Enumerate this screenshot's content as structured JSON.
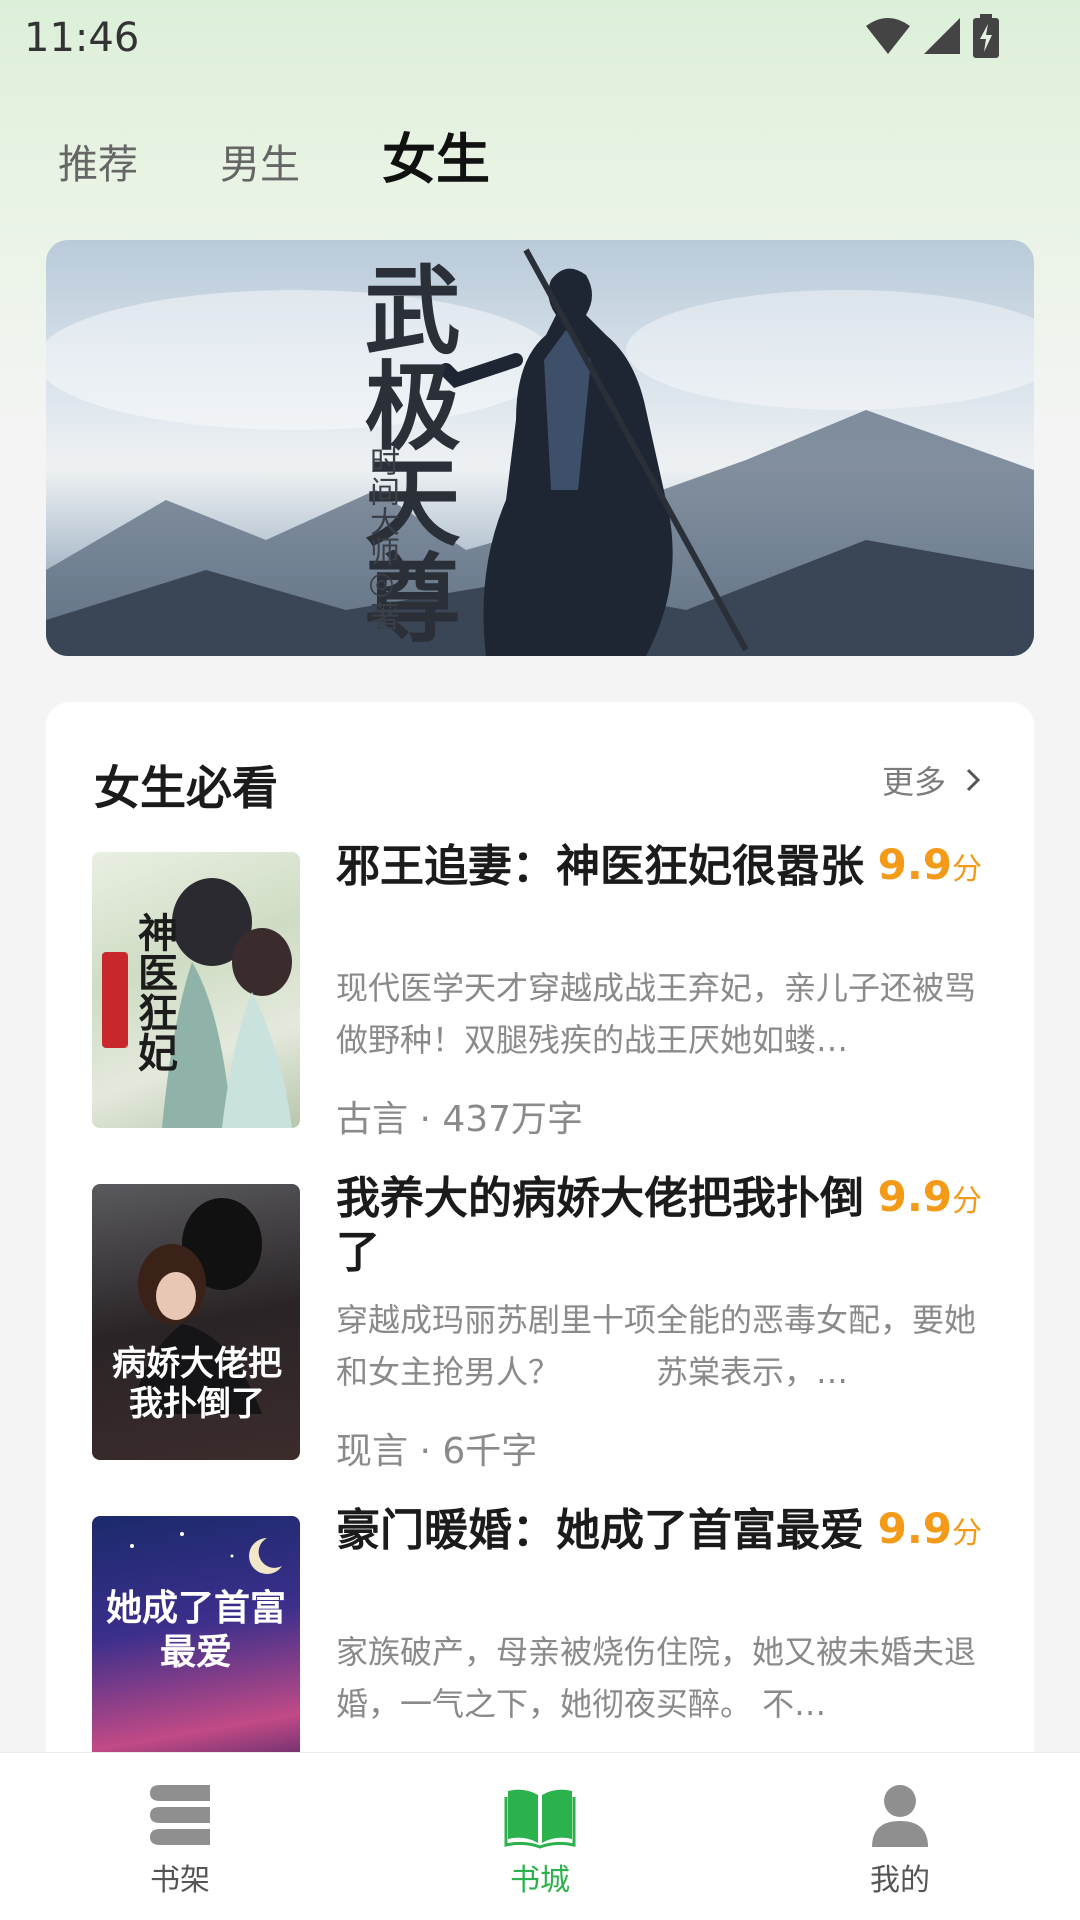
{
  "status_bar": {
    "time": "11:46"
  },
  "tabs": [
    {
      "label": "推荐",
      "active": false
    },
    {
      "label": "男生",
      "active": false
    },
    {
      "label": "女生",
      "active": true
    }
  ],
  "banner": {
    "title": "武极天尊",
    "author": "时间大师◎著"
  },
  "section": {
    "title": "女生必看",
    "more_label": "更多"
  },
  "books": [
    {
      "title": "邪王追妻：神医狂妃很嚣张",
      "rating": "9.9",
      "rating_unit": "分",
      "description": "现代医学天才穿越成战王弃妃，亲儿子还被骂做野种！双腿残疾的战王厌她如蝼…",
      "meta": "古言 · 437万字",
      "cover_text": "神医狂妃"
    },
    {
      "title": "我养大的病娇大佬把我扑倒了",
      "rating": "9.9",
      "rating_unit": "分",
      "description": "穿越成玛丽苏剧里十项全能的恶毒女配，要她和女主抢男人？　　　苏棠表示，…",
      "meta": "现言 · 6千字",
      "cover_text": "病娇大佬把我扑倒了"
    },
    {
      "title": "豪门暖婚：她成了首富最爱",
      "rating": "9.9",
      "rating_unit": "分",
      "description": "家族破产，母亲被烧伤住院，她又被未婚夫退婚，一气之下，她彻夜买醉。 不…",
      "meta": "",
      "cover_text": "她成了首富最爱"
    }
  ],
  "bottom_nav": [
    {
      "label": "书架",
      "icon": "bookshelf-icon",
      "active": false
    },
    {
      "label": "书城",
      "icon": "open-book-icon",
      "active": true
    },
    {
      "label": "我的",
      "icon": "user-icon",
      "active": false
    }
  ],
  "colors": {
    "accent": "#2bb24c",
    "rating": "#f39a19",
    "muted_text": "#8a8a8a"
  }
}
